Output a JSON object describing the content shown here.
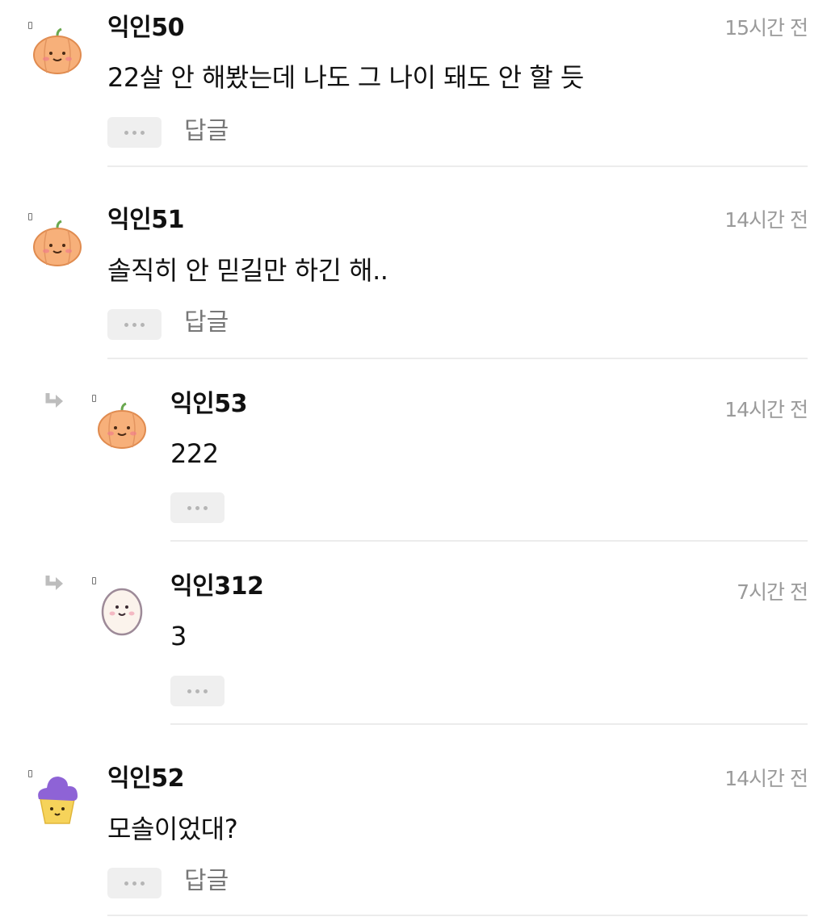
{
  "comments": [
    {
      "nick": "익인50",
      "time": "15시간 전",
      "text": "22살 안 해봤는데 나도 그 나이 돼도 안 할 듯",
      "reply_label": "답글",
      "avatar": "pumpkin"
    },
    {
      "nick": "익인51",
      "time": "14시간 전",
      "text": "솔직히 안 믿길만 하긴 해..",
      "reply_label": "답글",
      "avatar": "pumpkin"
    },
    {
      "nick": "익인53",
      "time": "14시간 전",
      "text": "222",
      "avatar": "pumpkin",
      "is_reply": true
    },
    {
      "nick": "익인312",
      "time": "7시간 전",
      "text": "3",
      "avatar": "egg",
      "is_reply": true
    },
    {
      "nick": "익인52",
      "time": "14시간 전",
      "text": "모솔이었대?",
      "reply_label": "답글",
      "avatar": "cupcake"
    }
  ],
  "icons": {
    "more": "more-dots-icon",
    "reply_arrow": "reply-arrow-icon",
    "badge": "user-badge-icon"
  },
  "colors": {
    "time": "#9a9a9a",
    "button_bg": "#efefef",
    "divider": "#ececec",
    "pumpkin": "#f6b27a",
    "cupcake_frosting": "#8e63d6",
    "cupcake_base": "#f6d35a"
  }
}
